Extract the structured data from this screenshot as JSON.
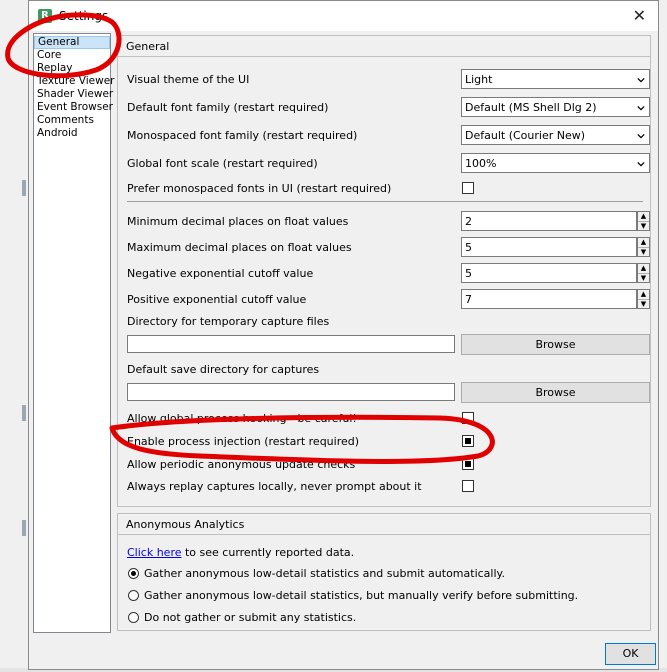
{
  "window": {
    "title": "Settings",
    "icon_letter": "R"
  },
  "categories": [
    {
      "label": "General",
      "selected": true
    },
    {
      "label": "Core",
      "selected": false
    },
    {
      "label": "Replay",
      "selected": false
    },
    {
      "label": "Texture Viewer",
      "selected": false
    },
    {
      "label": "Shader Viewer",
      "selected": false
    },
    {
      "label": "Event Browser",
      "selected": false
    },
    {
      "label": "Comments",
      "selected": false
    },
    {
      "label": "Android",
      "selected": false
    }
  ],
  "general": {
    "title": "General",
    "visual_theme": {
      "label": "Visual theme of the UI",
      "value": "Light"
    },
    "default_font": {
      "label": "Default font family (restart required)",
      "value": "Default (MS Shell Dlg 2)"
    },
    "mono_font": {
      "label": "Monospaced font family (restart required)",
      "value": "Default (Courier New)"
    },
    "font_scale": {
      "label": "Global font scale (restart required)",
      "value": "100%"
    },
    "prefer_mono": {
      "label": "Prefer monospaced fonts in UI (restart required)",
      "checked": false
    },
    "min_decimal": {
      "label": "Minimum decimal places on float values",
      "value": "2"
    },
    "max_decimal": {
      "label": "Maximum decimal places on float values",
      "value": "5"
    },
    "neg_cutoff": {
      "label": "Negative exponential cutoff value",
      "value": "5"
    },
    "pos_cutoff": {
      "label": "Positive exponential cutoff value",
      "value": "7"
    },
    "temp_dir": {
      "label": "Directory for temporary capture files",
      "value": "",
      "browse": "Browse"
    },
    "save_dir": {
      "label": "Default save directory for captures",
      "value": "",
      "browse": "Browse"
    },
    "global_hooking": {
      "label": "Allow global process hooking - be careful!",
      "checked": false
    },
    "process_injection": {
      "label": "Enable process injection (restart required)",
      "checked": true
    },
    "update_checks": {
      "label": "Allow periodic anonymous update checks",
      "checked": true
    },
    "replay_local": {
      "label": "Always replay captures locally, never prompt about it",
      "checked": false
    }
  },
  "analytics": {
    "title": "Anonymous Analytics",
    "link_text": "Click here",
    "link_suffix": " to see currently reported data.",
    "options": [
      {
        "label": "Gather anonymous low-detail statistics and submit automatically.",
        "checked": true
      },
      {
        "label": "Gather anonymous low-detail statistics, but manually verify before submitting.",
        "checked": false
      },
      {
        "label": "Do not gather or submit any statistics.",
        "checked": false
      }
    ]
  },
  "ok_label": "OK",
  "colors": {
    "annotation": "#e00000",
    "selection": "#cce4f7",
    "link": "#0000ee"
  }
}
